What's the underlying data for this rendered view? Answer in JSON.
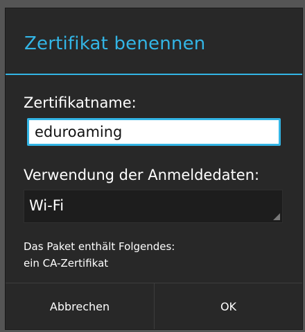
{
  "dialog": {
    "title": "Zertifikat benennen",
    "name_label": "Zertifikatname:",
    "name_value": "eduroaming",
    "usage_label": "Verwendung der Anmeldedaten:",
    "usage_value": "Wi-Fi",
    "info_line1": "Das Paket enthält Folgendes:",
    "info_line2": "ein CA-Zertifikat"
  },
  "buttons": {
    "cancel": "Abbrechen",
    "ok": "OK"
  },
  "colors": {
    "accent": "#33b5e5",
    "dialog_bg": "#282828"
  }
}
